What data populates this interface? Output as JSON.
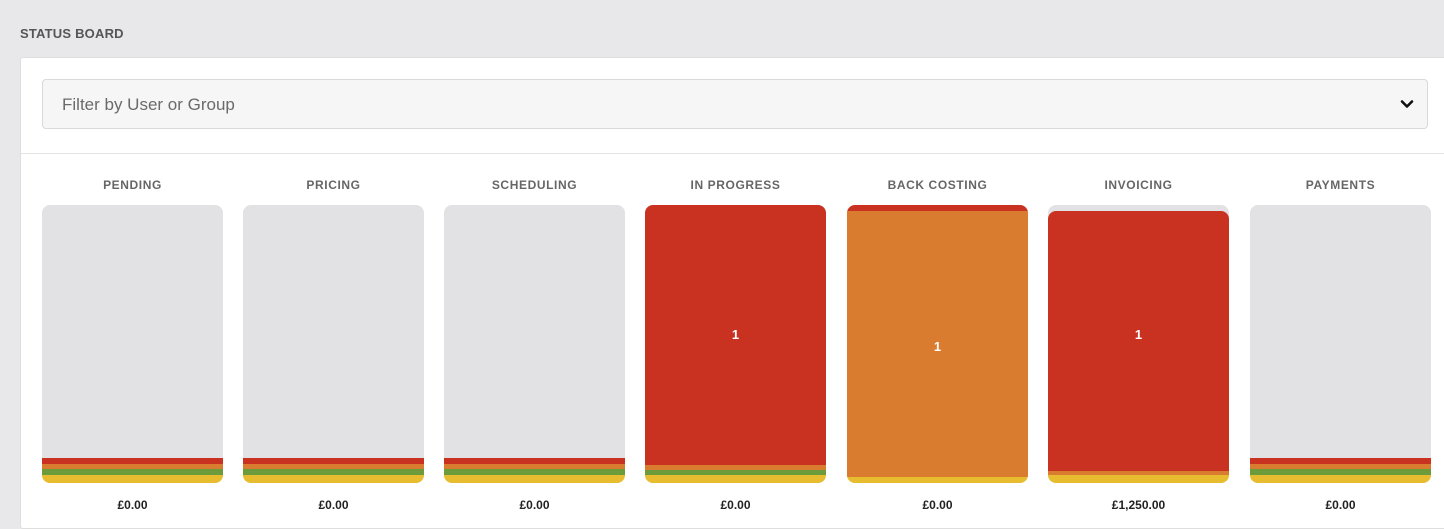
{
  "board": {
    "title": "STATUS BOARD"
  },
  "filter": {
    "placeholder": "Filter by User or Group"
  },
  "colors": {
    "red": "#c93220",
    "orange": "#d97c2f",
    "green": "#6b9b3a",
    "yellow": "#e7bd2f",
    "empty": "#e2e2e4"
  },
  "columns": [
    {
      "label": "PENDING",
      "total": "£0.00",
      "count": "",
      "fill": 0,
      "color": "red"
    },
    {
      "label": "PRICING",
      "total": "£0.00",
      "count": "",
      "fill": 0,
      "color": "red"
    },
    {
      "label": "SCHEDULING",
      "total": "£0.00",
      "count": "",
      "fill": 0,
      "color": "red"
    },
    {
      "label": "IN PROGRESS",
      "total": "£0.00",
      "count": "1",
      "fill": 1,
      "color": "red"
    },
    {
      "label": "BACK COSTING",
      "total": "£0.00",
      "count": "1",
      "fill": 1,
      "color": "orange"
    },
    {
      "label": "INVOICING",
      "total": "£1,250.00",
      "count": "1",
      "fill": 1,
      "color": "red"
    },
    {
      "label": "PAYMENTS",
      "total": "£0.00",
      "count": "",
      "fill": 0,
      "color": "red"
    }
  ]
}
